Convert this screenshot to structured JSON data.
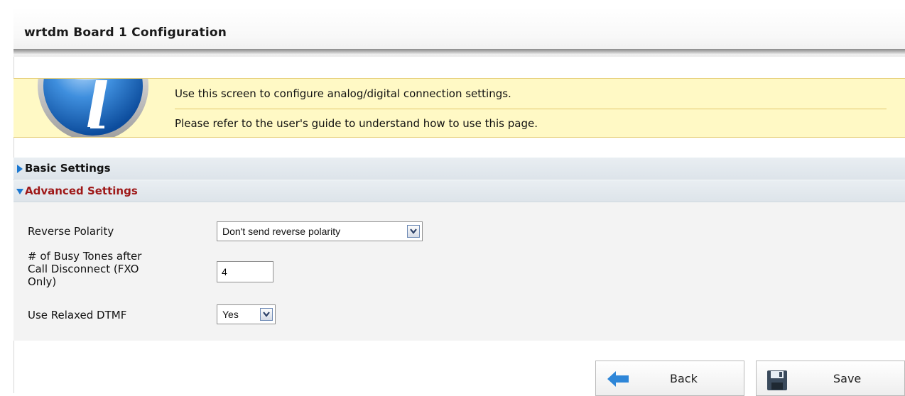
{
  "page": {
    "title": "wrtdm Board 1 Configuration"
  },
  "info": {
    "line1": "Use this screen to configure analog/digital connection settings.",
    "line2": "Please refer to the user's guide to understand how to use this page."
  },
  "sections": {
    "basic": "Basic Settings",
    "advanced": "Advanced Settings"
  },
  "settings": {
    "reverse_polarity": {
      "label": "Reverse Polarity",
      "value": "Don't send reverse polarity"
    },
    "busy_tones": {
      "label_line1": "# of Busy Tones after",
      "label_line2": "Call Disconnect (FXO",
      "label_line3": "Only)",
      "value": "4"
    },
    "relaxed_dtmf": {
      "label": "Use Relaxed DTMF",
      "value": "Yes"
    }
  },
  "actions": {
    "back": "Back",
    "save": "Save"
  },
  "colors": {
    "info_background": "#fff9c5",
    "section_header": "#e2e8ed",
    "advanced_label": "#9e1818",
    "arrow_blue": "#1b78d1",
    "panel_background": "#f3f3f3"
  }
}
